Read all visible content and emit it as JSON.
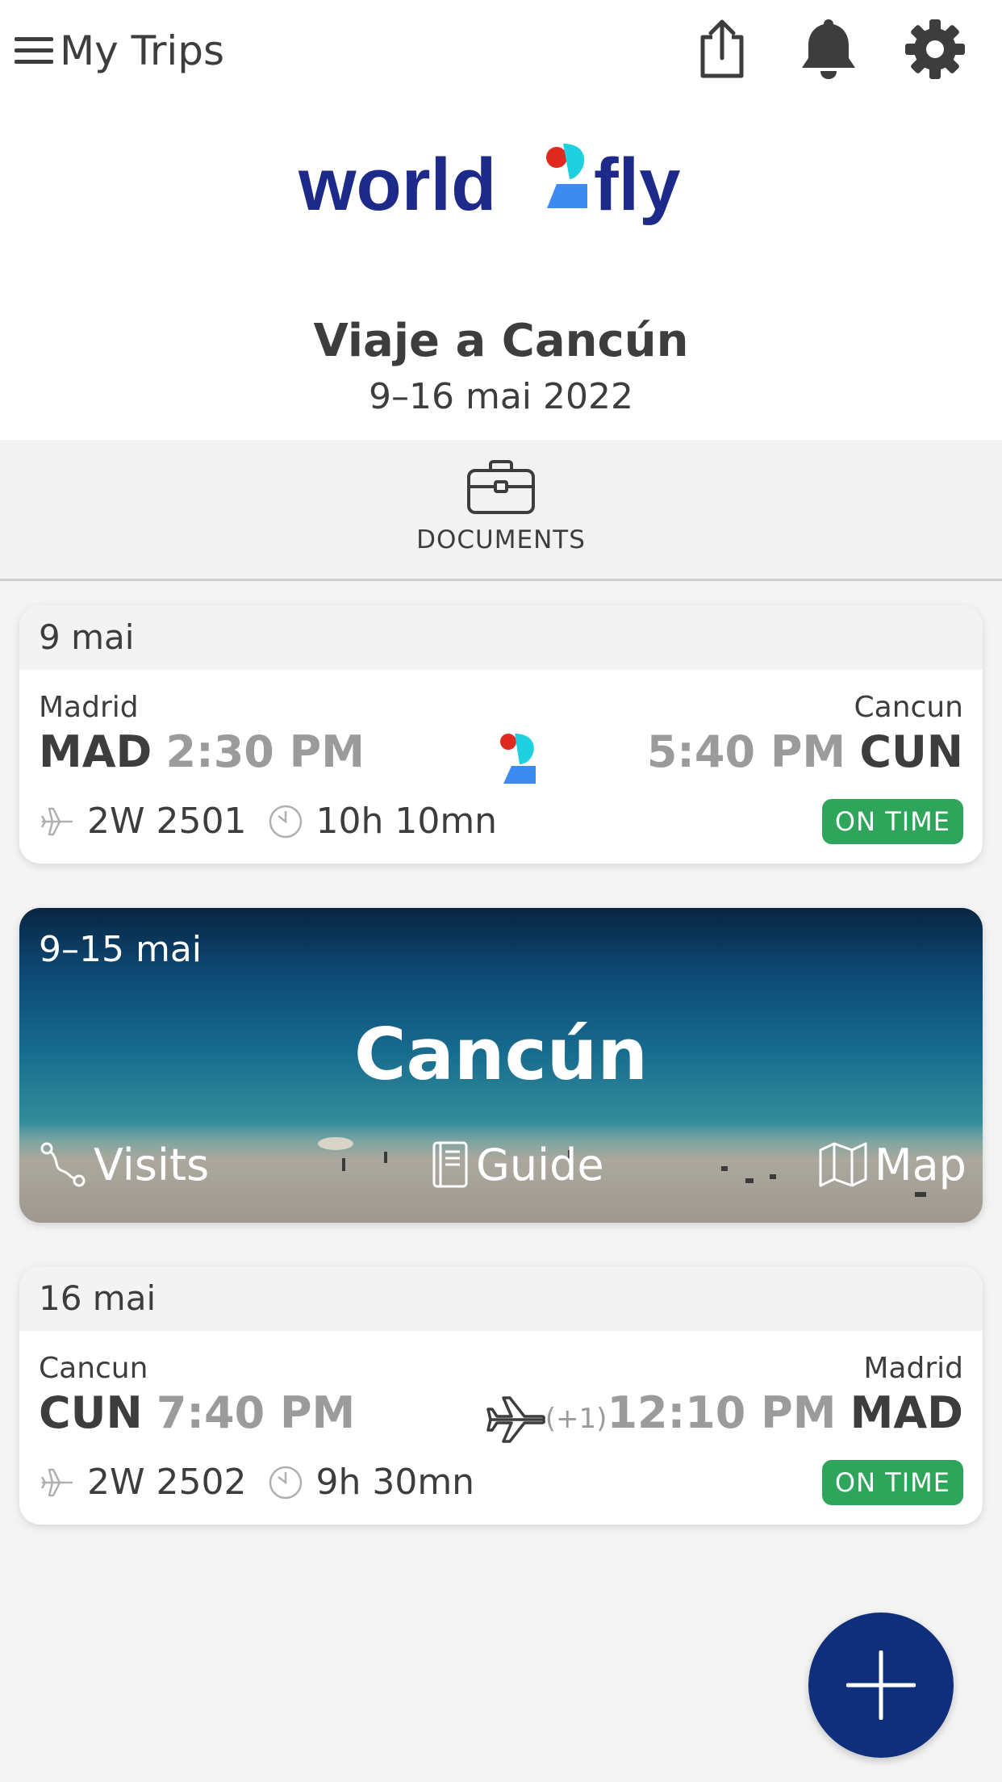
{
  "topbar": {
    "title": "My Trips",
    "menu_icon": "hamburger-menu-icon",
    "share_icon": "share-icon",
    "notifications_icon": "bell-icon",
    "settings_icon": "gear-icon"
  },
  "brand": {
    "logo_text_left": "world",
    "logo_text_right": "fly",
    "logo_glyph": "2",
    "colors": {
      "navy": "#1d2a8a",
      "red": "#e0291f",
      "cyan": "#1fd0e0",
      "blue": "#3b8bf0"
    }
  },
  "trip": {
    "title": "Viaje a Cancún",
    "dates": "9–16 mai 2022"
  },
  "documents": {
    "label": "DOCUMENTS",
    "icon": "briefcase-icon"
  },
  "flights": [
    {
      "date": "9 mai",
      "origin_city": "Madrid",
      "origin_code": "MAD",
      "departure_time": "2:30 PM",
      "dest_city": "Cancun",
      "dest_code": "CUN",
      "arrival_time": "5:40 PM",
      "day_offset": "",
      "flight_number": "2W 2501",
      "duration": "10h 10mn",
      "status": "ON TIME",
      "middle_icon": "airline-logo-icon"
    },
    {
      "date": "16 mai",
      "origin_city": "Cancun",
      "origin_code": "CUN",
      "departure_time": "7:40 PM",
      "dest_city": "Madrid",
      "dest_code": "MAD",
      "arrival_time": "12:10 PM",
      "day_offset": "(+1)",
      "flight_number": "2W 2502",
      "duration": "9h 30mn",
      "status": "ON TIME",
      "middle_icon": "airplane-icon"
    }
  ],
  "destination": {
    "dates": "9–15 mai",
    "name": "Cancún",
    "actions": [
      {
        "label": "Visits",
        "icon": "route-icon"
      },
      {
        "label": "Guide",
        "icon": "book-icon"
      },
      {
        "label": "Map",
        "icon": "map-icon"
      }
    ]
  },
  "fab": {
    "icon": "plus-icon",
    "color": "#0f2f7d"
  },
  "status_color": "#2ea55a"
}
